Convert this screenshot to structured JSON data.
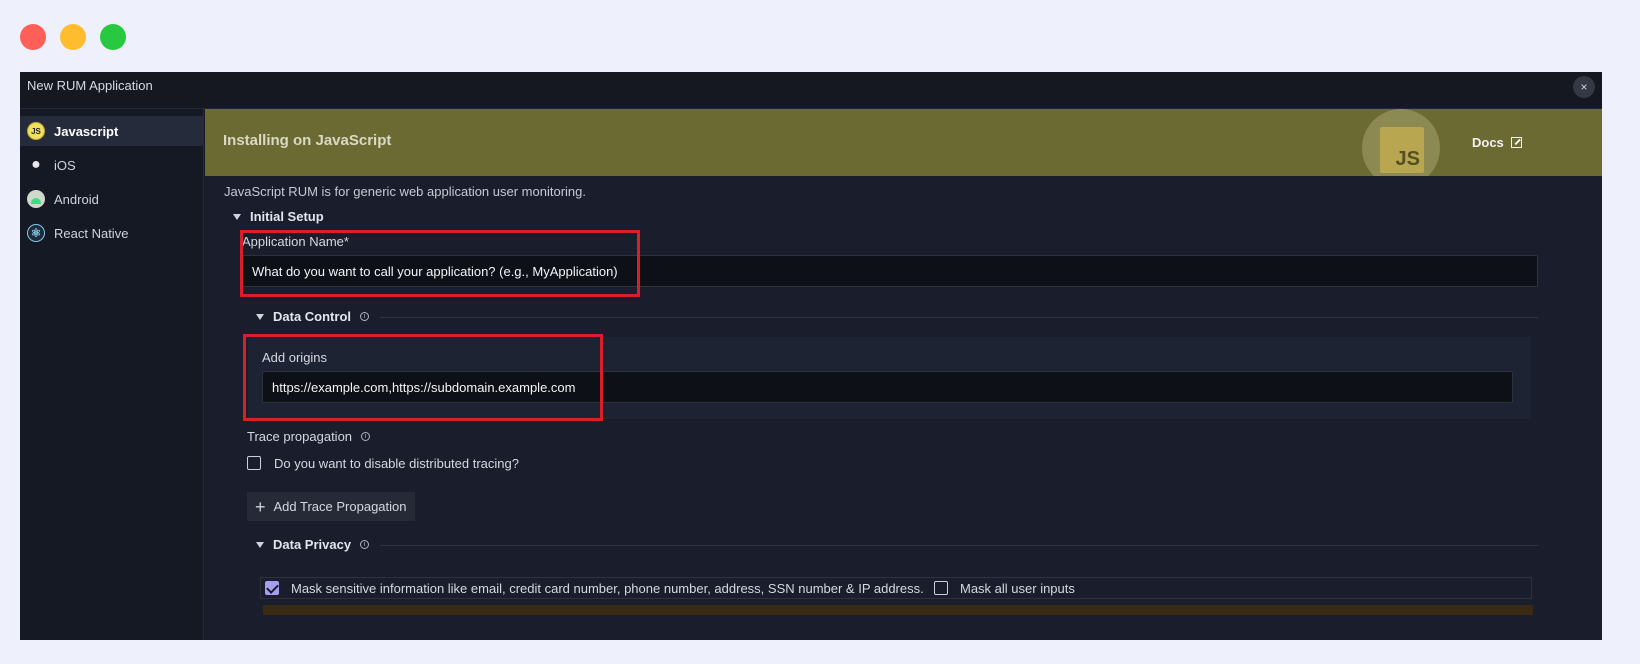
{
  "window": {
    "title": "New RUM Application",
    "close_label": "×"
  },
  "sidebar": {
    "items": [
      {
        "label": "Javascript",
        "icon": "js-icon",
        "active": true
      },
      {
        "label": "iOS",
        "icon": "apple-icon",
        "active": false
      },
      {
        "label": "Android",
        "icon": "android-icon",
        "active": false
      },
      {
        "label": "React Native",
        "icon": "react-icon",
        "active": false
      }
    ]
  },
  "banner": {
    "title": "Installing on JavaScript",
    "logo_text": "JS",
    "docs_label": "Docs",
    "color": "#6a6a32"
  },
  "main": {
    "description": "JavaScript RUM is for generic web application user monitoring.",
    "initial_setup": {
      "heading": "Initial Setup",
      "app_name_label": "Application Name*",
      "app_name_placeholder": "What do you want to call your application? (e.g., MyApplication)"
    },
    "data_control": {
      "heading": "Data Control",
      "origins_label": "Add origins",
      "origins_placeholder": "https://example.com,https://subdomain.example.com",
      "trace_label": "Trace propagation",
      "disable_tracing_label": "Do you want to disable distributed tracing?",
      "disable_tracing_checked": false,
      "add_trace_label": "Add Trace Propagation"
    },
    "data_privacy": {
      "heading": "Data Privacy",
      "mask_sensitive_label": "Mask sensitive information like email, credit card number, phone number, address, SSN number & IP address.",
      "mask_sensitive_checked": true,
      "mask_inputs_label": "Mask all user inputs",
      "mask_inputs_checked": false
    }
  },
  "colors": {
    "highlight": "#d8202a",
    "checkbox_accent": "#a5a0ee"
  }
}
